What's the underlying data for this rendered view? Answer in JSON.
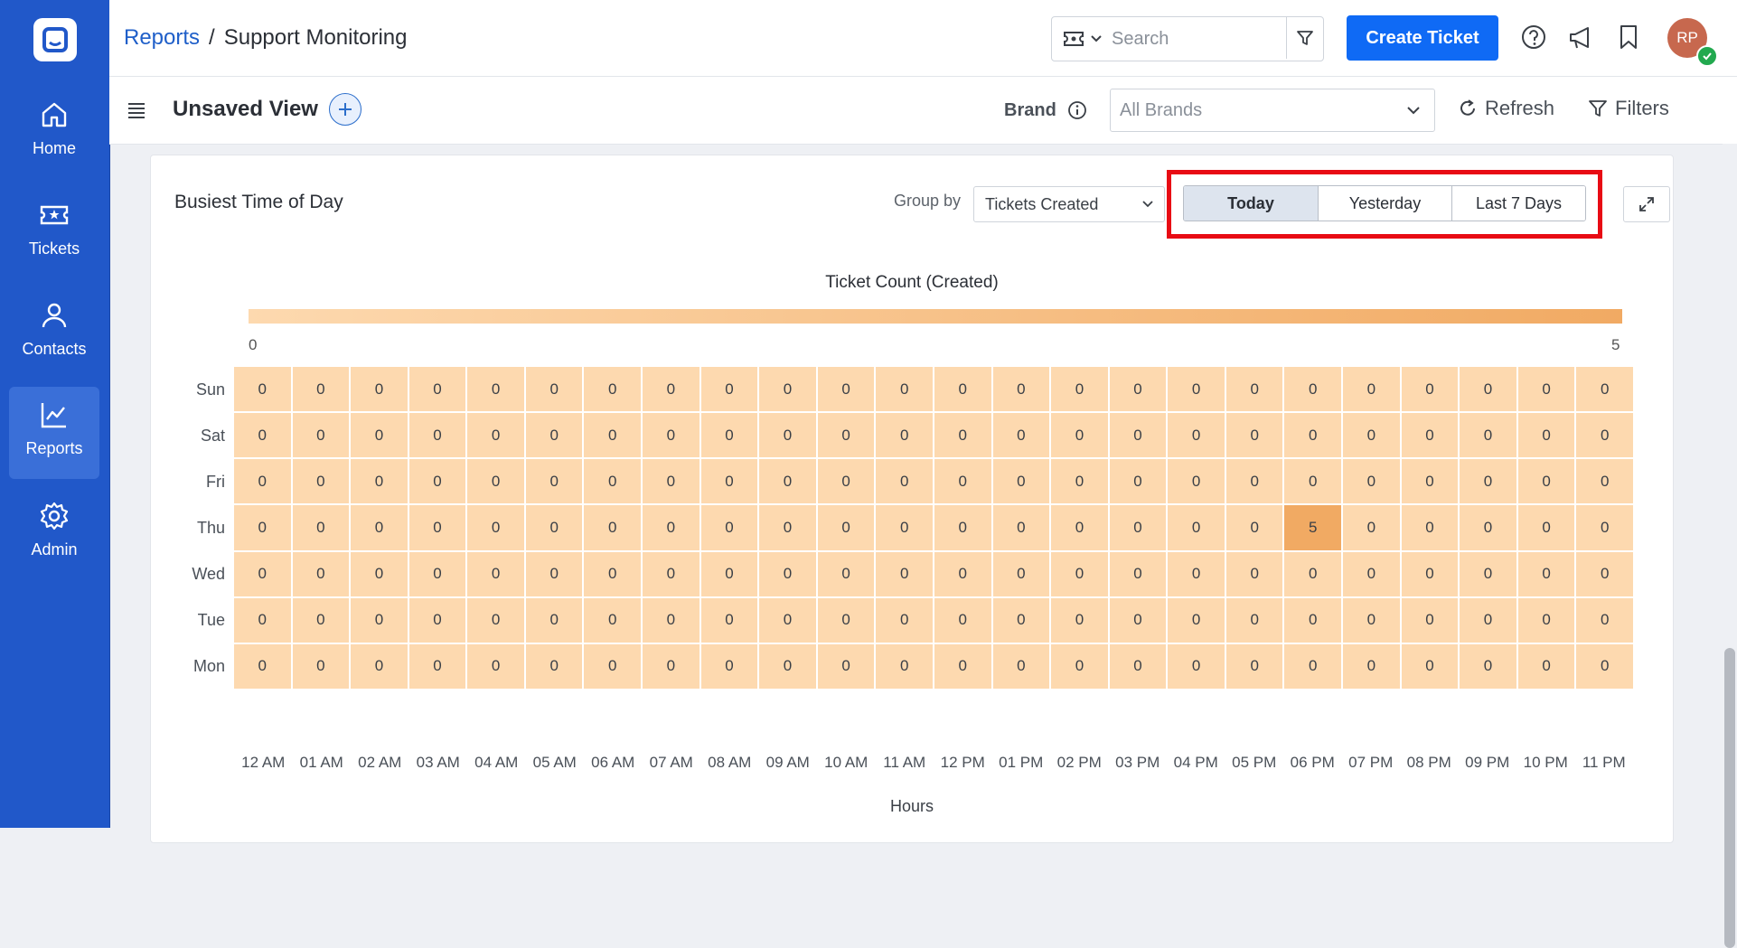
{
  "nav": {
    "items": [
      {
        "label": "Home",
        "icon": "home-icon"
      },
      {
        "label": "Tickets",
        "icon": "ticket-icon"
      },
      {
        "label": "Contacts",
        "icon": "person-icon"
      },
      {
        "label": "Reports",
        "icon": "chart-icon",
        "active": true
      },
      {
        "label": "Admin",
        "icon": "gear-icon"
      }
    ]
  },
  "header": {
    "breadcrumb_root": "Reports",
    "breadcrumb_sep": "/",
    "breadcrumb_current": "Support Monitoring",
    "search_placeholder": "Search",
    "create_ticket_label": "Create Ticket",
    "avatar_initials": "RP"
  },
  "viewbar": {
    "title": "Unsaved View",
    "brand_label": "Brand",
    "brand_value": "All Brands",
    "refresh_label": "Refresh",
    "filters_label": "Filters"
  },
  "card": {
    "title": "Busiest Time of Day",
    "groupby_label": "Group by",
    "groupby_value": "Tickets Created",
    "ranges": [
      "Today",
      "Yesterday",
      "Last 7 Days"
    ],
    "active_range": "Today"
  },
  "colors": {
    "accent": "#0f6af5",
    "rail": "#2158c9",
    "cell_low": "#fdd9af",
    "cell_high": "#f1aa63",
    "highlight": "#e80b14"
  },
  "chart_data": {
    "type": "heatmap",
    "legend_title": "Ticket Count (Created)",
    "scale_min": 0,
    "scale_max": 5,
    "xlabel": "Hours",
    "ylabel": "",
    "x": [
      "12 AM",
      "01 AM",
      "02 AM",
      "03 AM",
      "04 AM",
      "05 AM",
      "06 AM",
      "07 AM",
      "08 AM",
      "09 AM",
      "10 AM",
      "11 AM",
      "12 PM",
      "01 PM",
      "02 PM",
      "03 PM",
      "04 PM",
      "05 PM",
      "06 PM",
      "07 PM",
      "08 PM",
      "09 PM",
      "10 PM",
      "11 PM"
    ],
    "y": [
      "Sun",
      "Sat",
      "Fri",
      "Thu",
      "Wed",
      "Tue",
      "Mon"
    ],
    "values": [
      [
        0,
        0,
        0,
        0,
        0,
        0,
        0,
        0,
        0,
        0,
        0,
        0,
        0,
        0,
        0,
        0,
        0,
        0,
        0,
        0,
        0,
        0,
        0,
        0
      ],
      [
        0,
        0,
        0,
        0,
        0,
        0,
        0,
        0,
        0,
        0,
        0,
        0,
        0,
        0,
        0,
        0,
        0,
        0,
        0,
        0,
        0,
        0,
        0,
        0
      ],
      [
        0,
        0,
        0,
        0,
        0,
        0,
        0,
        0,
        0,
        0,
        0,
        0,
        0,
        0,
        0,
        0,
        0,
        0,
        0,
        0,
        0,
        0,
        0,
        0
      ],
      [
        0,
        0,
        0,
        0,
        0,
        0,
        0,
        0,
        0,
        0,
        0,
        0,
        0,
        0,
        0,
        0,
        0,
        0,
        5,
        0,
        0,
        0,
        0,
        0
      ],
      [
        0,
        0,
        0,
        0,
        0,
        0,
        0,
        0,
        0,
        0,
        0,
        0,
        0,
        0,
        0,
        0,
        0,
        0,
        0,
        0,
        0,
        0,
        0,
        0
      ],
      [
        0,
        0,
        0,
        0,
        0,
        0,
        0,
        0,
        0,
        0,
        0,
        0,
        0,
        0,
        0,
        0,
        0,
        0,
        0,
        0,
        0,
        0,
        0,
        0
      ],
      [
        0,
        0,
        0,
        0,
        0,
        0,
        0,
        0,
        0,
        0,
        0,
        0,
        0,
        0,
        0,
        0,
        0,
        0,
        0,
        0,
        0,
        0,
        0,
        0
      ]
    ]
  }
}
